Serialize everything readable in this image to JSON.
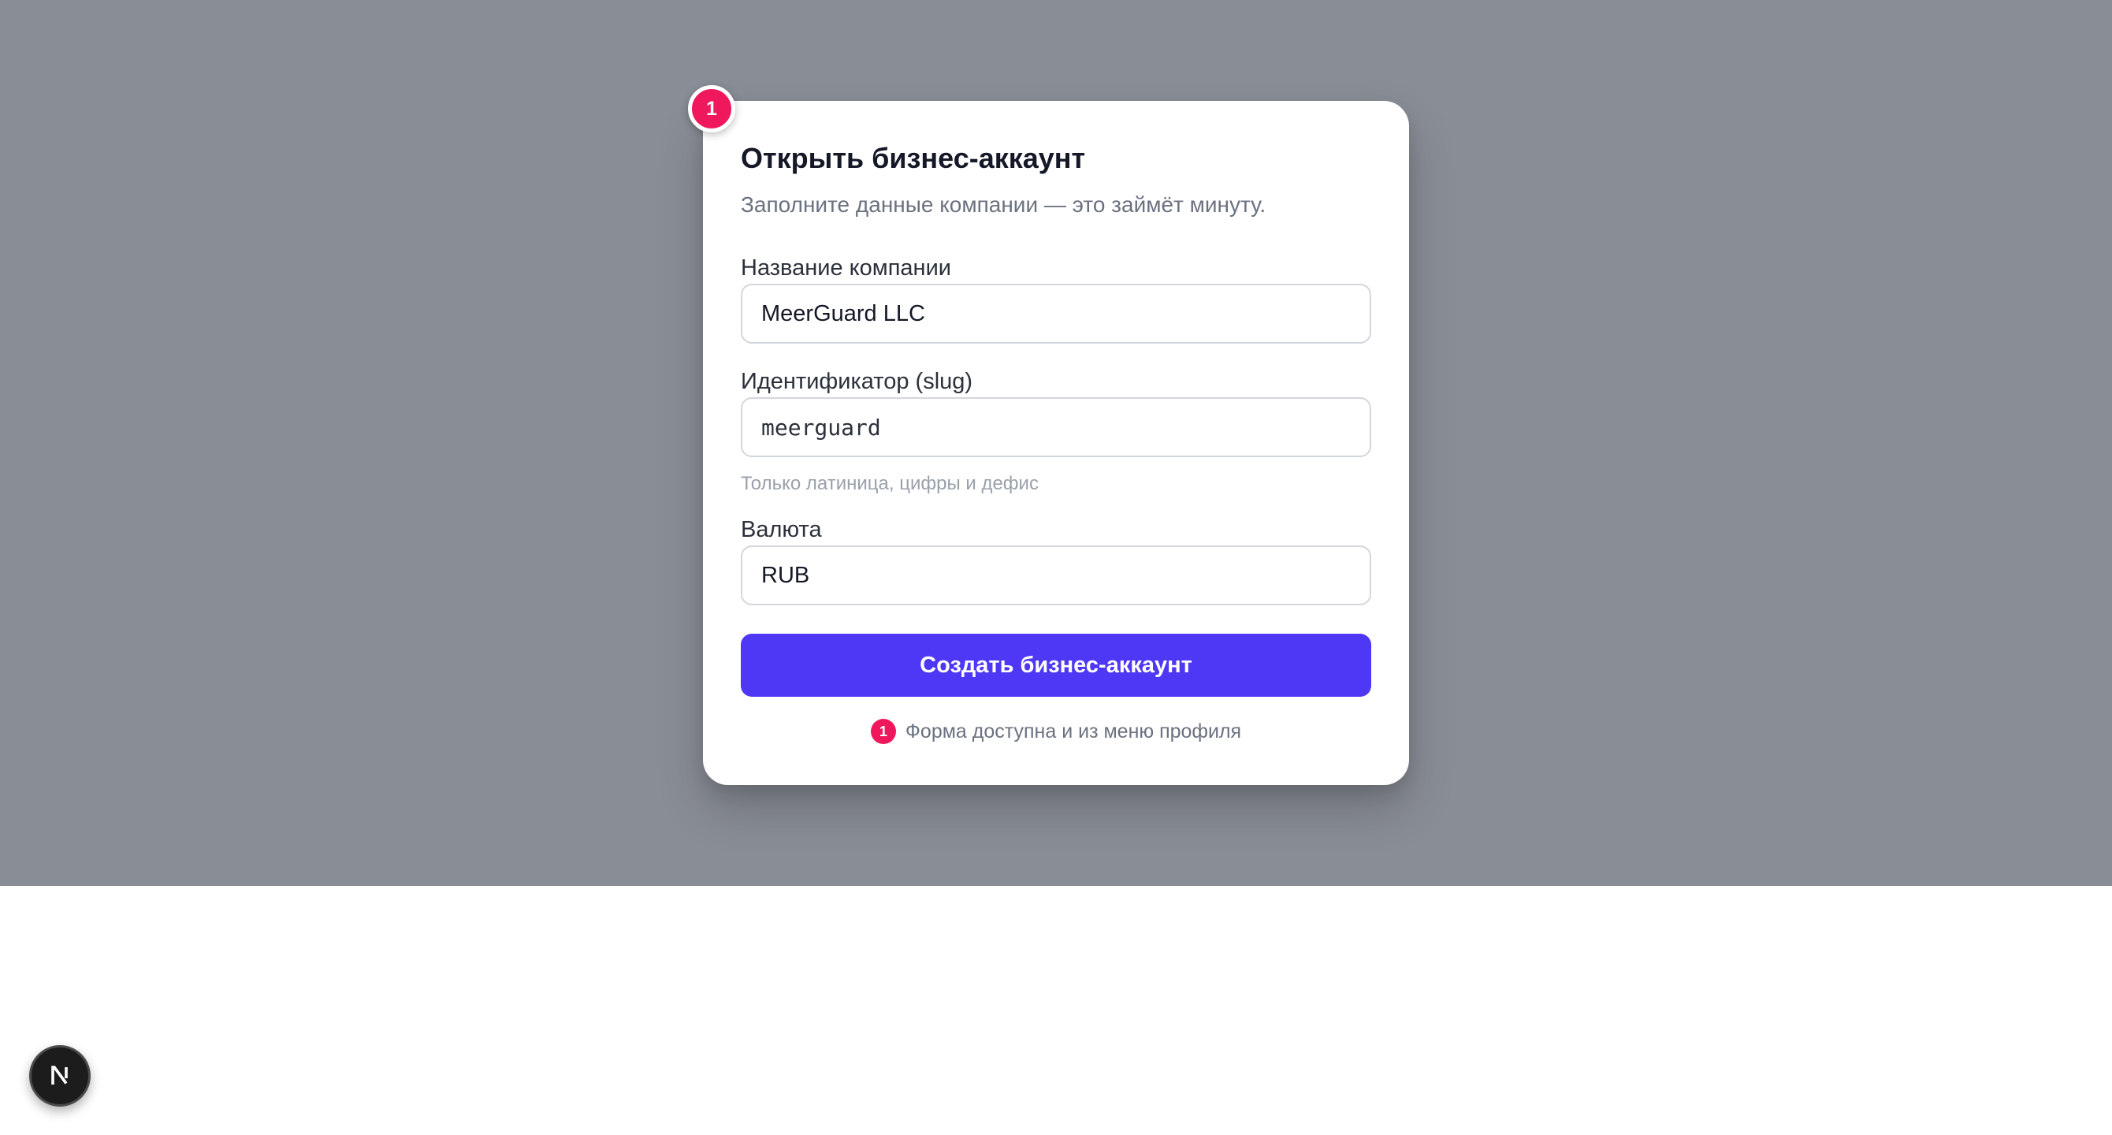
{
  "modal": {
    "step_number": "1",
    "title": "Открыть бизнес-аккаунт",
    "subtitle": "Заполните данные компании — это займёт минуту.",
    "company_name": {
      "label": "Название компании",
      "value": "MeerGuard LLC"
    },
    "slug": {
      "label": "Идентификатор (slug)",
      "value": "meerguard",
      "hint": "Только латиница, цифры и дефис"
    },
    "currency": {
      "label": "Валюта",
      "value": "RUB"
    },
    "submit_label": "Создать бизнес-аккаунт",
    "footnote": {
      "badge": "1",
      "text": "Форма доступна и из меню профиля"
    }
  },
  "colors": {
    "overlay": "#898d96",
    "primary": "#4f38f5",
    "badge": "#f0185d"
  },
  "icons": {
    "dev_tools": "nextjs-logo-icon"
  }
}
